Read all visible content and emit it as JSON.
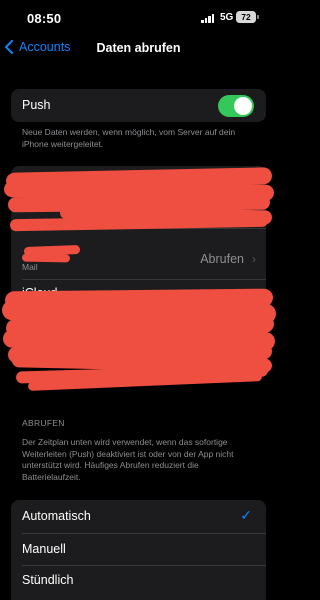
{
  "status_bar": {
    "time": "08:50",
    "network": "5G",
    "battery": "72"
  },
  "nav": {
    "back_label": "Accounts",
    "title": "Daten abrufen"
  },
  "push": {
    "label": "Push",
    "enabled": true,
    "footnote": "Neue Daten werden, wenn möglich, vom Server auf dein iPhone weitergeleitet."
  },
  "accounts": [
    {
      "name": "",
      "subtitle": ""
    },
    {
      "name": "",
      "subtitle": "Mail",
      "value": "Abrufen"
    },
    {
      "name": "iCloud",
      "subtitle": ""
    }
  ],
  "fetch": {
    "header": "ABRUFEN",
    "footnote": "Der Zeitplan unten wird verwendet, wenn das sofortige Weiterleiten (Push) deaktiviert ist oder von der App nicht unterstützt wird. Häufiges Abrufen reduziert die Batterielaufzeit.",
    "options": [
      {
        "label": "Automatisch",
        "selected": true
      },
      {
        "label": "Manuell",
        "selected": false
      },
      {
        "label": "Stündlich",
        "selected": false
      }
    ]
  },
  "colors": {
    "accent": "#0a84ff",
    "toggle_on": "#34c759",
    "redaction": "#ee4f40"
  }
}
